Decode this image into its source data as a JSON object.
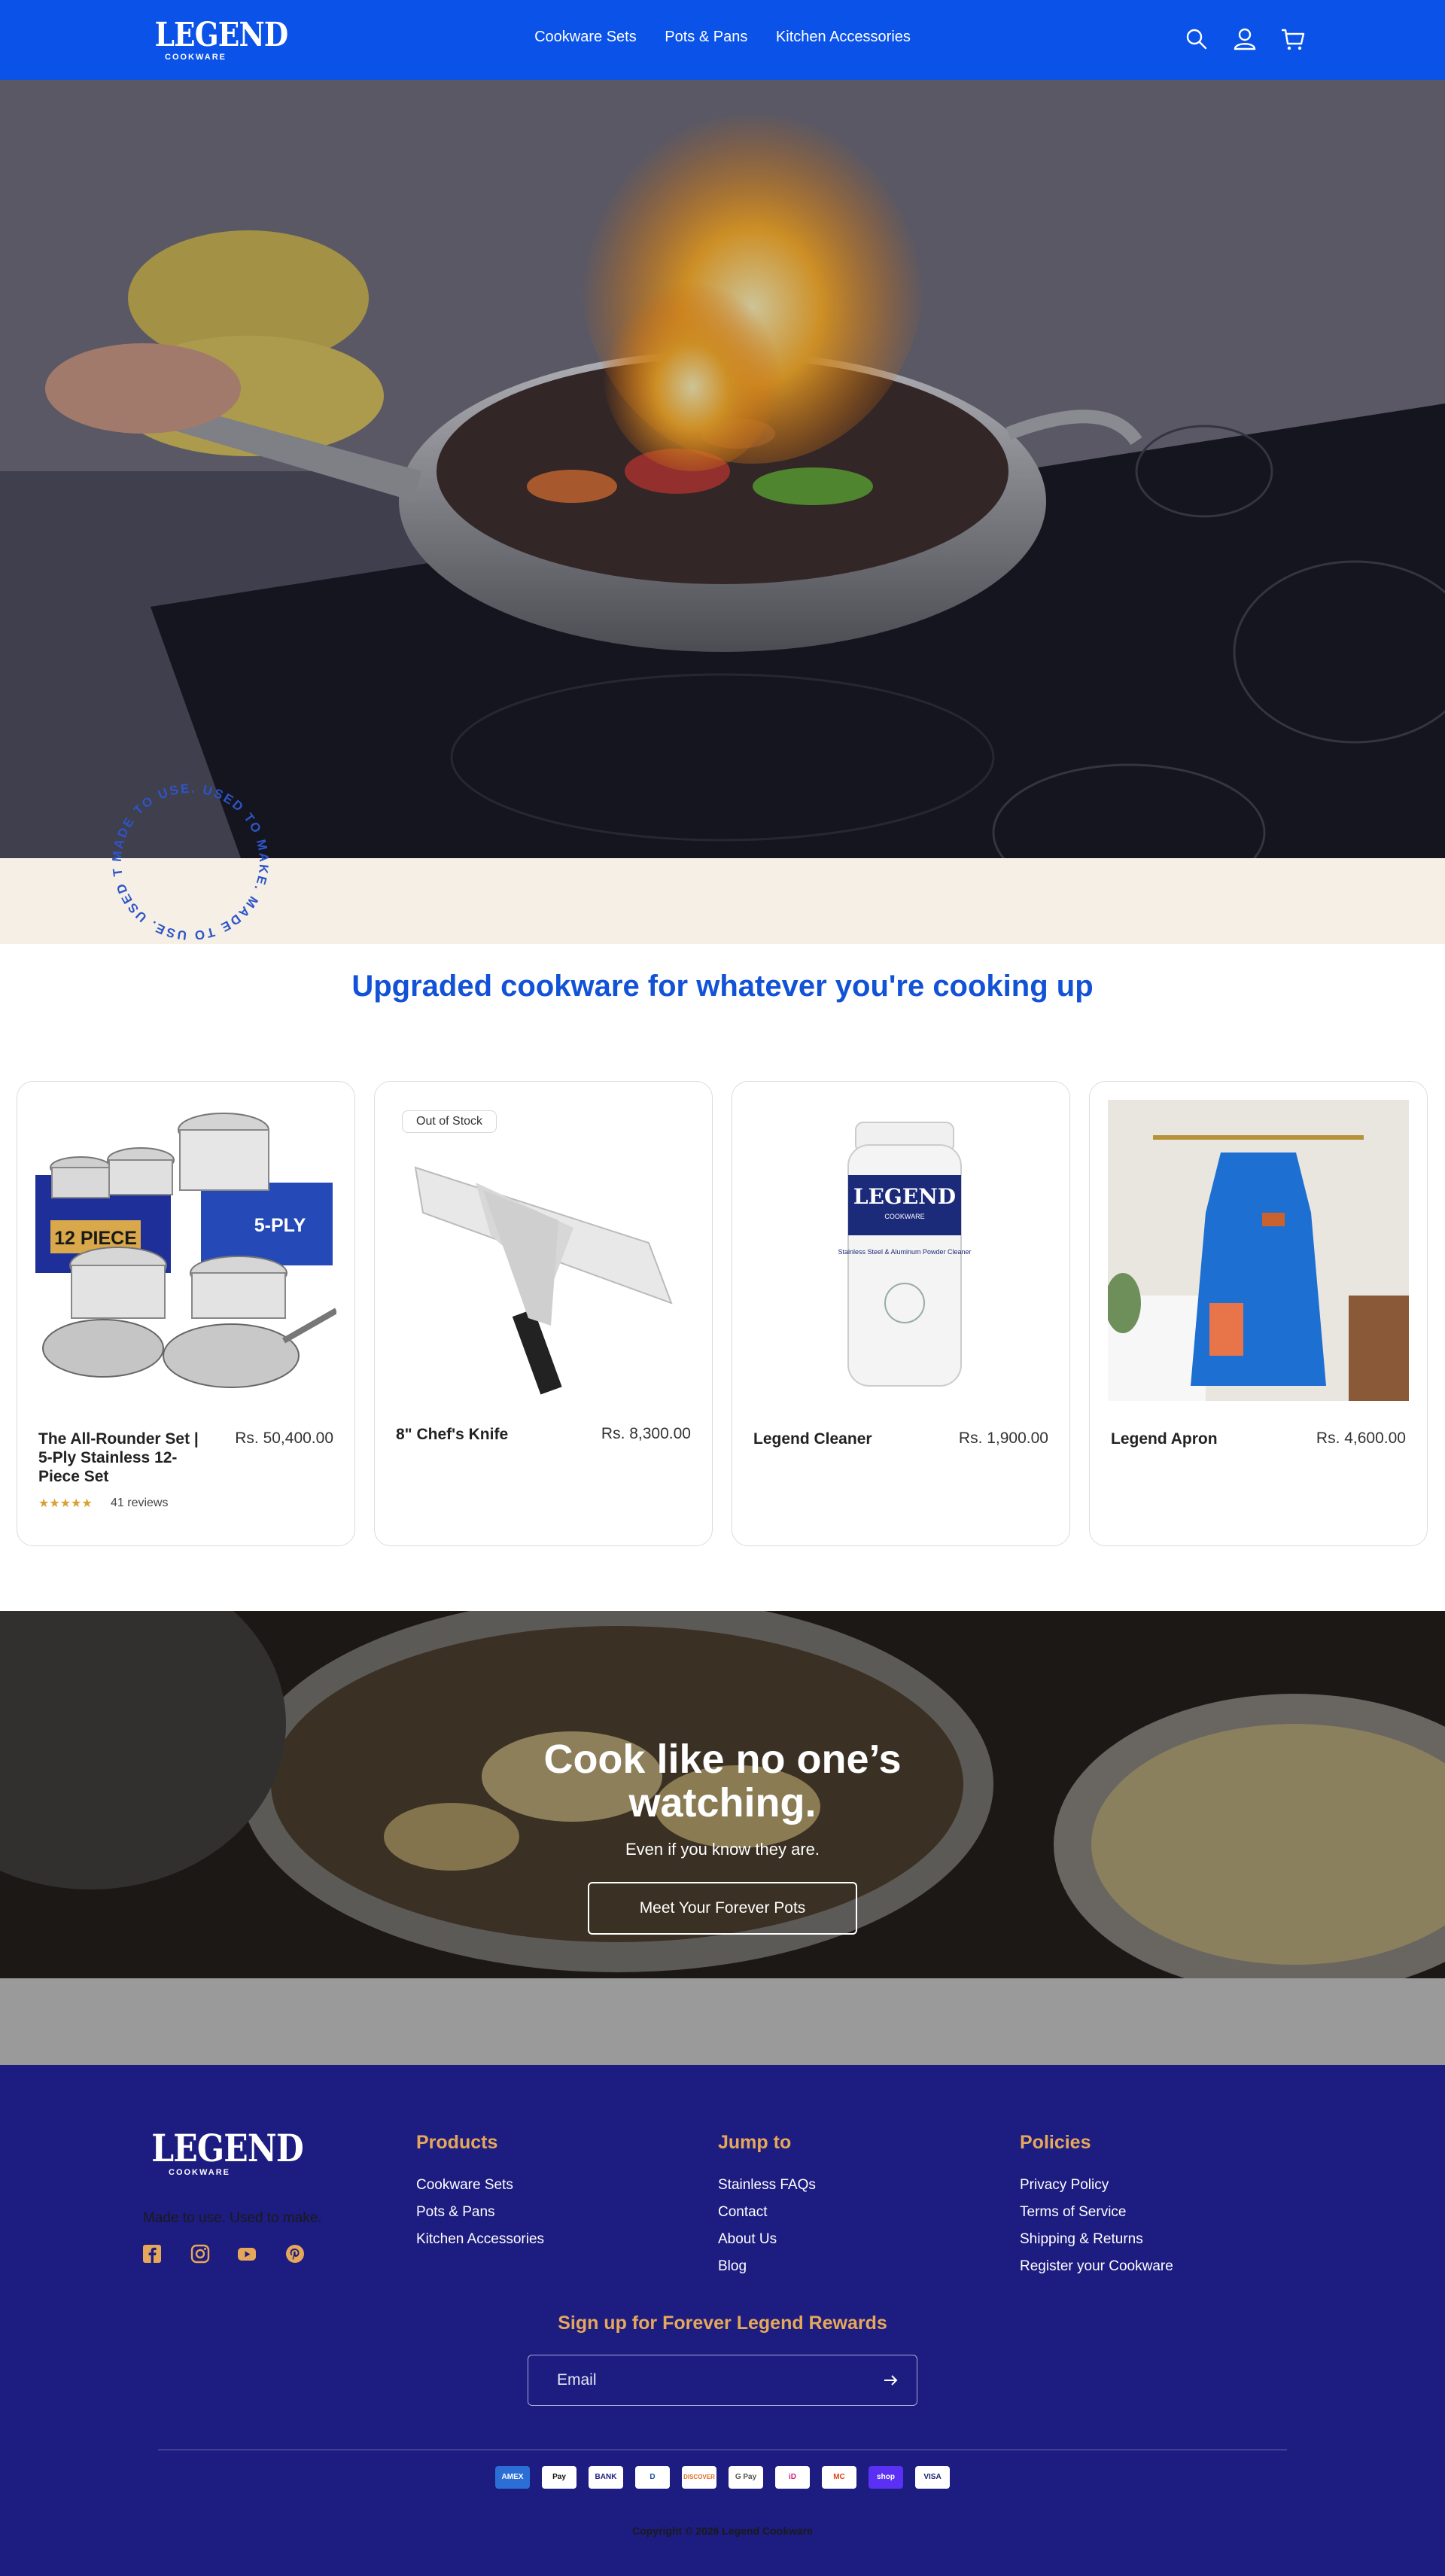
{
  "brand": {
    "name": "LEGEND",
    "sub": "COOKWARE"
  },
  "nav": {
    "items": [
      "Cookware Sets",
      "Pots & Pans",
      "Kitchen Accessories"
    ]
  },
  "header_icons": [
    "search-icon",
    "account-icon",
    "cart-icon"
  ],
  "hero": {
    "stamp_text": "MADE TO USE. USED TO MAKE. MADE TO USE. USED TO MAKE."
  },
  "section": {
    "title": "Upgraded cookware for whatever you're cooking up"
  },
  "products": [
    {
      "name": "The All-Rounder Set | 5-Ply Stainless 12-Piece Set",
      "price": "Rs. 50,400.00",
      "stars": "★★★★★",
      "reviews": "41 reviews",
      "box_label": "12 PIECE",
      "box_label_2": "5-PLY"
    },
    {
      "name": "8\" Chef's Knife",
      "price": "Rs. 8,300.00",
      "badge": "Out of Stock"
    },
    {
      "name": "Legend Cleaner",
      "price": "Rs. 1,900.00",
      "label_brand": "LEGEND",
      "label_sub": "COOKWARE",
      "label_text": "Stainless Steel & Aluminum Powder Cleaner"
    },
    {
      "name": "Legend Apron",
      "price": "Rs. 4,600.00"
    }
  ],
  "banner": {
    "title_line1": "Cook like no one’s",
    "title_line2": "watching.",
    "subtitle": "Even if you know they are.",
    "button": "Meet Your Forever Pots"
  },
  "footer": {
    "tagline": "Made to use. Used to make.",
    "social": [
      "facebook-icon",
      "instagram-icon",
      "youtube-icon",
      "pinterest-icon"
    ],
    "columns": [
      {
        "title": "Products",
        "links": [
          "Cookware Sets",
          "Pots & Pans",
          "Kitchen Accessories"
        ]
      },
      {
        "title": "Jump to",
        "links": [
          "Stainless FAQs",
          "Contact",
          "About Us",
          "Blog"
        ]
      },
      {
        "title": "Policies",
        "links": [
          "Privacy Policy",
          "Terms of Service",
          "Shipping & Returns",
          "Register your Cookware"
        ]
      }
    ],
    "signup_title": "Sign up for Forever Legend Rewards",
    "email_placeholder": "Email",
    "payments": [
      "AMEX",
      "Pay",
      "BANK",
      "D",
      "DISCOVER",
      "G Pay",
      "iD",
      "MC",
      "shop",
      "VISA"
    ],
    "copyright": "Copyright © 2026 Legend Cookware"
  },
  "colors": {
    "header": "#0a52e8",
    "title": "#1252d6",
    "footer": "#1d1c80",
    "accent": "#e5a85a",
    "beige": "#f6efe5"
  }
}
